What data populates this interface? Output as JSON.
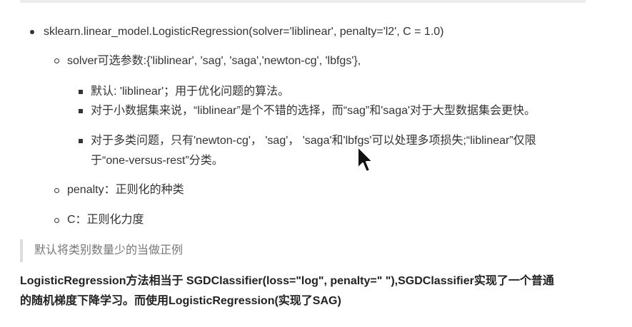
{
  "list": {
    "item1": "sklearn.linear_model.LogisticRegression(solver='liblinear', penalty='l2', C = 1.0)",
    "solver": "solver可选参数:{'liblinear', 'sag', 'saga','newton-cg', 'lbfgs'},",
    "solver_points": [
      "默认: 'liblinear'；用于优化问题的算法。",
      "对于小数据集来说，“liblinear”是个不错的选择，而“sag”和'saga'对于大型数据集会更快。",
      "对于多类问题，只有'newton-cg'， 'sag'， 'saga'和'lbfgs'可以处理多项损失;“liblinear”仅限",
      "于“one-versus-rest”分类。"
    ],
    "penalty": "penalty：正则化的种类",
    "c": "C：正则化力度"
  },
  "quote": "默认将类别数量少的当做正例",
  "paragraph": {
    "line1": "LogisticRegression方法相当于 SGDClassifier(loss=\"log\", penalty=\" \"),SGDClassifier实现了一个普通",
    "line2": "的随机梯度下降学习。而使用LogisticRegression(实现了SAG)"
  },
  "cursor_icon": "mouse-pointer-icon"
}
